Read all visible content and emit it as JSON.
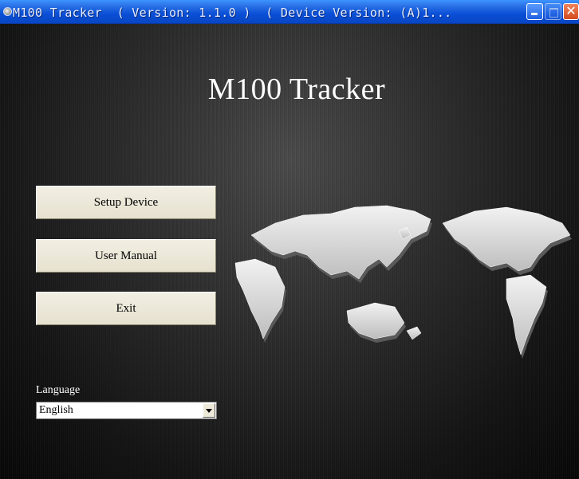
{
  "window": {
    "title": "M100 Tracker  ( Version: 1.1.0 )  ( Device Version: (A)1...",
    "controls": {
      "minimize": "minimize",
      "maximize": "maximize",
      "close": "close"
    }
  },
  "main": {
    "app_title": "M100 Tracker",
    "buttons": {
      "setup": "Setup Device",
      "manual": "User Manual",
      "exit": "Exit"
    },
    "language": {
      "label": "Language",
      "selected": "English"
    }
  },
  "icons": {
    "app": "app-icon",
    "minimize": "minimize-icon",
    "maximize": "maximize-icon",
    "close": "close-icon",
    "dropdown": "chevron-down-icon",
    "map": "world-map-icon"
  },
  "colors": {
    "titlebar": "#0a4fd6",
    "close_button": "#d24a1e",
    "button_face": "#ece8d8",
    "background": "#1a1a1a"
  }
}
